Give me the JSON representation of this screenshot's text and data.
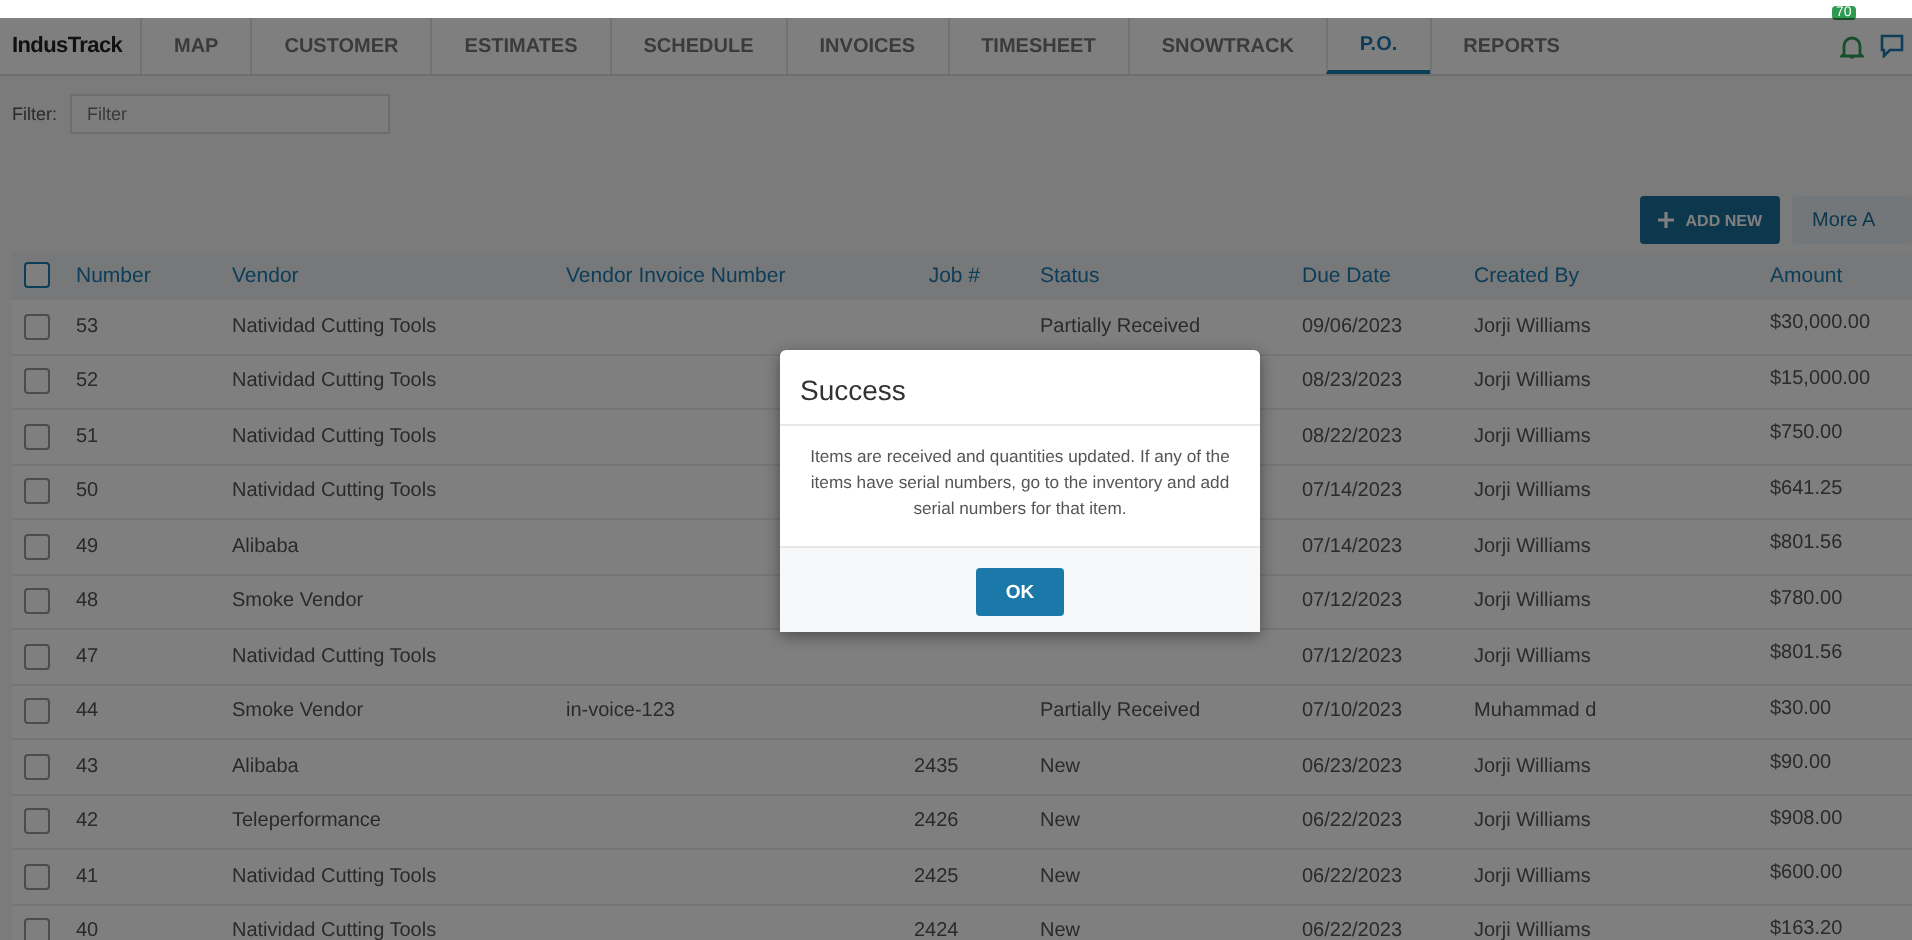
{
  "nav": {
    "logo": "IndusTrack",
    "tabs": [
      {
        "label": "MAP",
        "selected": false
      },
      {
        "label": "CUSTOMER",
        "selected": false
      },
      {
        "label": "ESTIMATES",
        "selected": false
      },
      {
        "label": "SCHEDULE",
        "selected": false
      },
      {
        "label": "INVOICES",
        "selected": false
      },
      {
        "label": "TIMESHEET",
        "selected": false
      },
      {
        "label": "SNOWTRACK",
        "selected": false
      },
      {
        "label": "P.O.",
        "selected": true
      },
      {
        "label": "REPORTS",
        "selected": false
      }
    ],
    "notification_badge": "70"
  },
  "filter": {
    "label": "Filter:",
    "placeholder": "Filter"
  },
  "actions": {
    "add_new": "ADD NEW",
    "more": "More A"
  },
  "table": {
    "all_checked": false,
    "columns": [
      "Number",
      "Vendor",
      "Vendor Invoice Number",
      "Job #",
      "Status",
      "Due Date",
      "Created By",
      "Amount"
    ],
    "rows": [
      {
        "checked": false,
        "number": "53",
        "vendor": "Natividad Cutting Tools",
        "status": "Partially Received",
        "due": "09/06/2023",
        "created_by": "Jorji Williams",
        "amount": "$30,000.00"
      },
      {
        "checked": false,
        "number": "52",
        "vendor": "Natividad Cutting Tools",
        "due": "08/23/2023",
        "created_by": "Jorji Williams",
        "amount": "$15,000.00"
      },
      {
        "checked": false,
        "number": "51",
        "vendor": "Natividad Cutting Tools",
        "due": "08/22/2023",
        "created_by": "Jorji Williams",
        "amount": "$750.00"
      },
      {
        "checked": false,
        "number": "50",
        "vendor": "Natividad Cutting Tools",
        "due": "07/14/2023",
        "created_by": "Jorji Williams",
        "amount": "$641.25"
      },
      {
        "checked": false,
        "number": "49",
        "vendor": "Alibaba",
        "due": "07/14/2023",
        "created_by": "Jorji Williams",
        "amount": "$801.56"
      },
      {
        "checked": false,
        "number": "48",
        "vendor": "Smoke Vendor",
        "due": "07/12/2023",
        "created_by": "Jorji Williams",
        "amount": "$780.00"
      },
      {
        "checked": false,
        "number": "47",
        "vendor": "Natividad Cutting Tools",
        "due": "07/12/2023",
        "created_by": "Jorji Williams",
        "amount": "$801.56"
      },
      {
        "checked": false,
        "number": "44",
        "vendor": "Smoke Vendor",
        "invoice": "in-voice-123",
        "status": "Partially Received",
        "due": "07/10/2023",
        "created_by": "Muhammad d",
        "amount": "$30.00"
      },
      {
        "checked": false,
        "number": "43",
        "vendor": "Alibaba",
        "job": "2435",
        "status": "New",
        "due": "06/23/2023",
        "created_by": "Jorji Williams",
        "amount": "$90.00"
      },
      {
        "checked": false,
        "number": "42",
        "vendor": "Teleperformance",
        "job": "2426",
        "status": "New",
        "due": "06/22/2023",
        "created_by": "Jorji Williams",
        "amount": "$908.00"
      },
      {
        "checked": false,
        "number": "41",
        "vendor": "Natividad Cutting Tools",
        "job": "2425",
        "status": "New",
        "due": "06/22/2023",
        "created_by": "Jorji Williams",
        "amount": "$600.00"
      },
      {
        "checked": false,
        "number": "40",
        "vendor": "Natividad Cutting Tools",
        "job": "2424",
        "status": "New",
        "due": "06/22/2023",
        "created_by": "Jorji Williams",
        "amount": "$163.20"
      }
    ]
  },
  "dialog": {
    "title": "Success",
    "message": "Items are received and quantities updated. If any of the items have serial numbers, go to the inventory and add serial numbers for that item.",
    "ok": "OK"
  }
}
